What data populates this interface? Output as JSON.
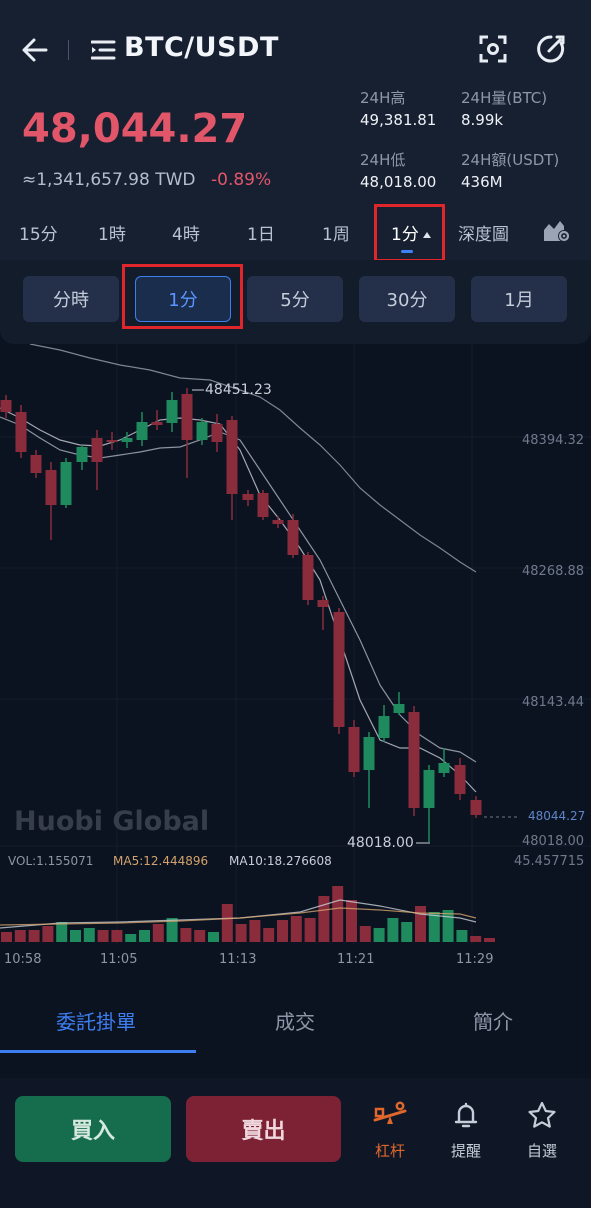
{
  "header": {
    "pair": "BTC/USDT",
    "price": "48,044.27",
    "fiat_value": "≈1,341,657.98 TWD",
    "change_pct": "-0.89%"
  },
  "stats": {
    "high_label": "24H高",
    "high_value": "49,381.81",
    "vol_btc_label": "24H量(BTC)",
    "vol_btc_value": "8.99k",
    "low_label": "24H低",
    "low_value": "48,018.00",
    "vol_usdt_label": "24H額(USDT)",
    "vol_usdt_value": "436M"
  },
  "period_tabs": [
    "15分",
    "1時",
    "4時",
    "1日",
    "1周",
    "1分",
    "深度圖"
  ],
  "sub_periods": [
    "分時",
    "1分",
    "5分",
    "30分",
    "1月"
  ],
  "chart": {
    "price_labels": [
      "48394.32",
      "48268.88",
      "48143.44",
      "48018.00"
    ],
    "current_price_label": "48044.27",
    "high_marker": "48451.23",
    "low_marker": "48018.00",
    "volume_max_label": "45.457715",
    "watermark": "Huobi Global",
    "vol_indicator": "VOL:1.155071",
    "ma5_indicator": "MA5:12.444896",
    "ma10_indicator": "MA10:18.276608",
    "time_labels": [
      "10:58",
      "11:05",
      "11:13",
      "11:21",
      "11:29"
    ],
    "colors": {
      "up": "#1f8a5e",
      "down": "#8a2c3c",
      "ma_line": "#c9ced7"
    }
  },
  "bottom_tabs": [
    "委託掛單",
    "成交",
    "簡介"
  ],
  "footer": {
    "buy": "買入",
    "sell": "賣出",
    "leverage": "杠杆",
    "alert": "提醒",
    "watchlist": "自選",
    "colors": {
      "buy": "#156d4d",
      "sell": "#7d2234",
      "accent": "#e0672c"
    }
  }
}
